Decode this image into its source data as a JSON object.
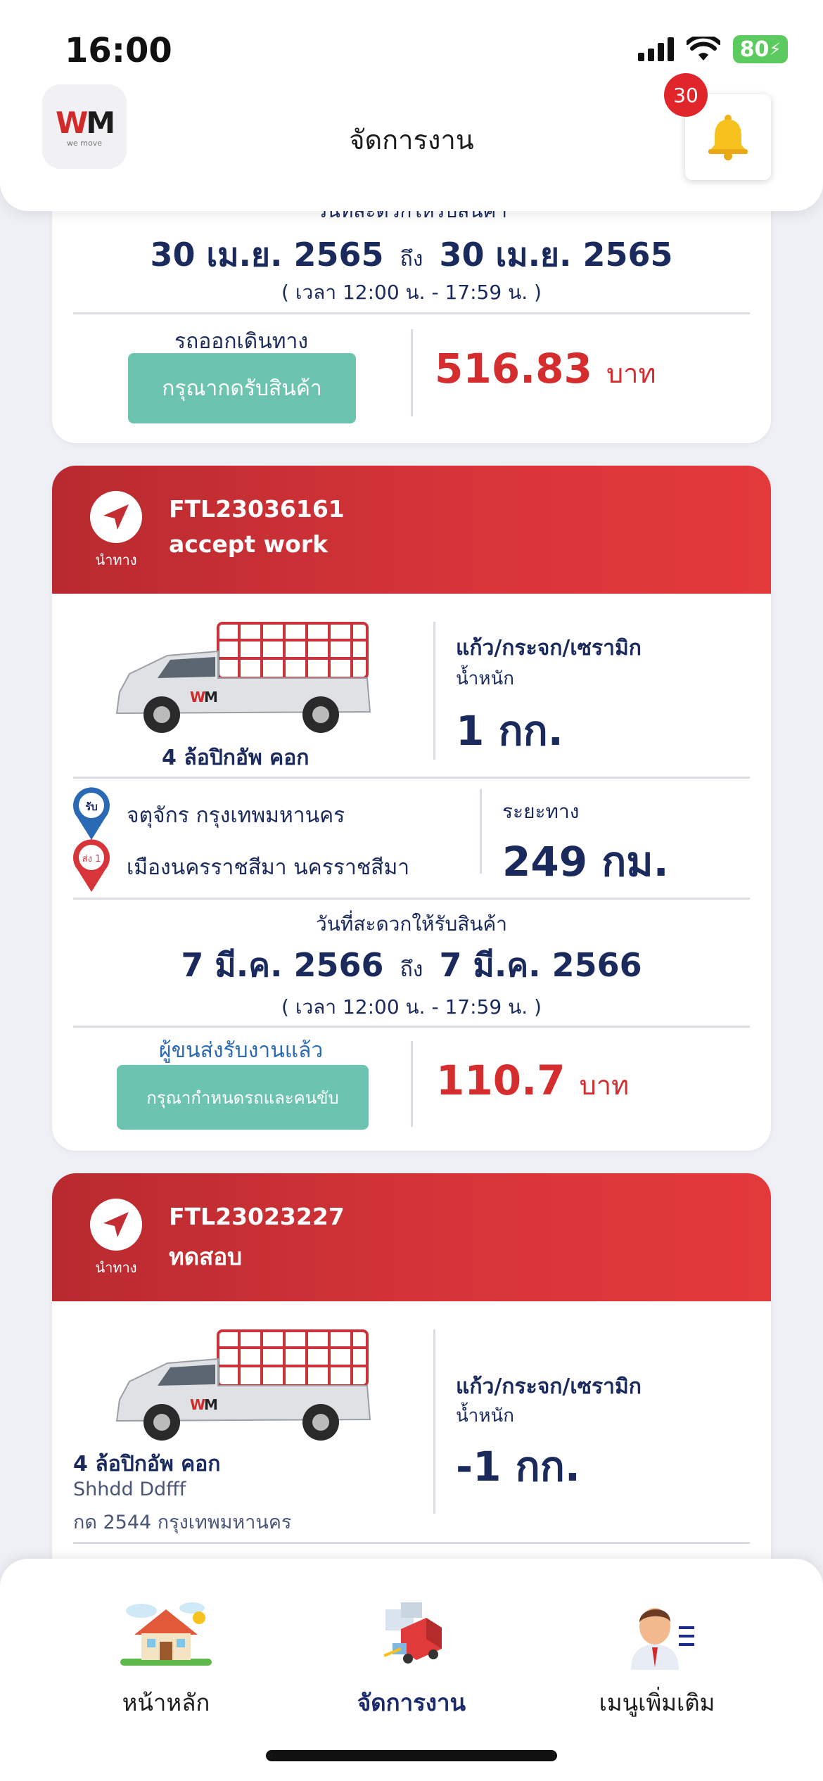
{
  "status_bar": {
    "time": "16:00",
    "battery": "80"
  },
  "header": {
    "logo_text_w": "W",
    "logo_text_m": "M",
    "logo_sub": "we move",
    "title": "จัดการงาน",
    "notification_count": "30"
  },
  "card0": {
    "date_label": "วันที่สะดวกให้รับสินค้า",
    "date_from": "30 เม.ย. 2565",
    "date_sep": "ถึง",
    "date_to": "30 เม.ย. 2565",
    "time_range": "( เวลา 12:00 น. - 17:59 น. )",
    "status_text": "รถออกเดินทาง",
    "button_label": "กรุณากดรับสินค้า",
    "price": "516.83",
    "currency": "บาท"
  },
  "card1": {
    "nav_label": "นำทาง",
    "job_code": "FTL23036161",
    "job_status": "accept work",
    "vehicle": "4 ล้อปิกอัพ คอก",
    "cargo_type": "แก้ว/กระจก/เซรามิก",
    "weight_label": "น้ำหนัก",
    "weight": "1 กก.",
    "pickup_pin": "รับ",
    "pickup": "จตุจักร กรุงเทพมหานคร",
    "drop_pin": "ส่ง 1",
    "dropoff": "เมืองนครราชสีมา นครราชสีมา",
    "distance_label": "ระยะทาง",
    "distance": "249 กม.",
    "date_label": "วันที่สะดวกให้รับสินค้า",
    "date_from": "7 มี.ค. 2566",
    "date_sep": "ถึง",
    "date_to": "7 มี.ค. 2566",
    "time_range": "( เวลา 12:00 น. - 17:59 น. )",
    "status_text": "ผู้ขนส่งรับงานแล้ว",
    "button_label": "กรุณากำหนดรถและคนขับ",
    "price": "110.7",
    "currency": "บาท"
  },
  "card2": {
    "nav_label": "นำทาง",
    "job_code": "FTL23023227",
    "job_status": "ทดสอบ",
    "vehicle": "4 ล้อปิกอัพ คอก",
    "driver": "Shhdd Ddfff",
    "plate": "กด 2544 กรุงเทพมหานคร",
    "cargo_type": "แก้ว/กระจก/เซรามิก",
    "weight_label": "น้ำหนัก",
    "weight": "-1 กก."
  },
  "bottom_nav": {
    "items": [
      {
        "label": "หน้าหลัก",
        "icon": "house-icon"
      },
      {
        "label": "จัดการงาน",
        "icon": "delivery-truck-icon"
      },
      {
        "label": "เมนูเพิ่มเติม",
        "icon": "person-menu-icon"
      }
    ],
    "active_index": 1
  },
  "colors": {
    "accent_red": "#d8353a",
    "button_green": "#6cc3b0",
    "navy": "#1a2a5c",
    "status_blue": "#2a6ab5"
  }
}
